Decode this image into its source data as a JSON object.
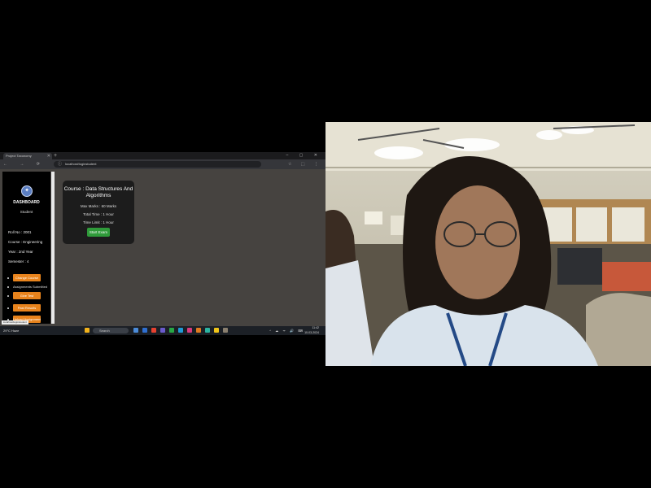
{
  "browser": {
    "tab_title": "Project Taxonomy",
    "address": "localhost/loginstudent",
    "new_tab_glyph": "+",
    "window_controls": "–  ▢  ✕",
    "nav_glyphs": "←  →  ⟳",
    "extension_glyphs": "☆ ⬚ ⋮"
  },
  "sidebar": {
    "logo_glyph": "✦",
    "name": "DASHBOARD",
    "role": "Student",
    "info": [
      "Roll No : 2001",
      "Course : Engineering",
      "Year : 2nd Year",
      "Semester : 4"
    ],
    "buttons": [
      "Change Course",
      "Give Test",
      "Past Results",
      "Student Profile"
    ],
    "section_label": "Assignments Submitted",
    "last_button": "Upload Assignment"
  },
  "course_card": {
    "title": "Course : Data Structures And Algorithms",
    "lines": [
      "Max Marks : 60 Marks",
      "Total Time : 1 Hour",
      "Time Limit : 1 Hour"
    ],
    "start_label": "Start Exam"
  },
  "status_url": "localhost/loginstudent",
  "taskbar": {
    "weather": "29°C Haze",
    "search_placeholder": "Search",
    "tray_icons": "^ ☁ ᯤ 🔊 ⌨",
    "time": "11:42",
    "date": "10-03-2024",
    "app_colors": [
      "#f2b21b",
      "#4b8bd8",
      "#2f6fd0",
      "#e8412f",
      "#6a5acd",
      "#27a745",
      "#1f9ad6",
      "#d83a7d",
      "#e07a1f",
      "#2bb3a0",
      "#f0c419",
      "#8a7f6e"
    ]
  },
  "camera": {
    "colors": {
      "ceiling": "#d8d4c4",
      "wall": "#b9b3a0",
      "window": "#f4f1e4",
      "shirt": "#d9e3ec",
      "hair": "#1e1712",
      "skin": "#a0775a"
    }
  }
}
